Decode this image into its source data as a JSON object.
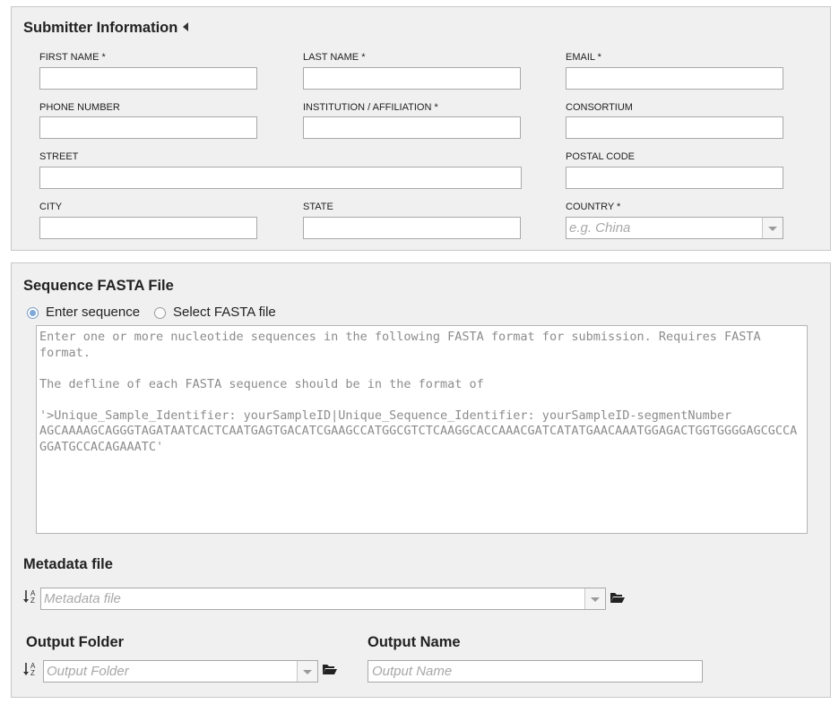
{
  "submitter": {
    "title": "Submitter Information",
    "first_name_label": "FIRST NAME *",
    "last_name_label": "LAST NAME *",
    "email_label": "EMAIL *",
    "phone_label": "PHONE NUMBER",
    "institution_label": "INSTITUTION / AFFILIATION *",
    "consortium_label": "CONSORTIUM",
    "street_label": "STREET",
    "postal_label": "POSTAL CODE",
    "city_label": "CITY",
    "state_label": "STATE",
    "country_label": "COUNTRY *",
    "country_placeholder": "e.g. China"
  },
  "sequence": {
    "title": "Sequence FASTA File",
    "option_enter": "Enter sequence",
    "option_select": "Select FASTA file",
    "textarea_placeholder": "Enter one or more nucleotide sequences in the following FASTA format for submission. Requires FASTA format.\n\nThe defline of each FASTA sequence should be in the format of\n\n'>Unique_Sample_Identifier: yourSampleID|Unique_Sequence_Identifier: yourSampleID-segmentNumber\nAGCAAAAGCAGGGTAGATAATCACTCAATGAGTGACATCGAAGCCATGGCGTCTCAAGGCACCAAACGATCATATGAACAAATGGAGACTGGTGGGGAGCGCCAGGATGCCACAGAAATC'"
  },
  "metadata": {
    "title": "Metadata file",
    "placeholder": "Metadata file"
  },
  "output": {
    "folder_title": "Output Folder",
    "folder_placeholder": "Output Folder",
    "name_title": "Output Name",
    "name_placeholder": "Output Name"
  }
}
